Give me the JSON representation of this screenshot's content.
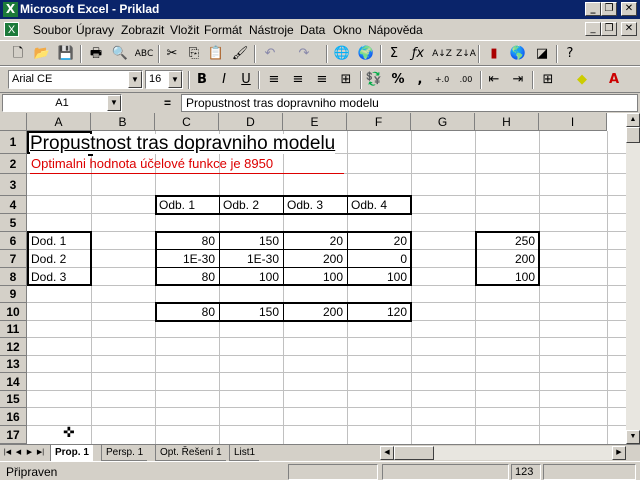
{
  "window": {
    "title": "Microsoft Excel - Priklad",
    "app_icon": "excel-x-icon"
  },
  "menu": [
    "Soubor",
    "Úpravy",
    "Zobrazit",
    "Vložit",
    "Formát",
    "Nástroje",
    "Data",
    "Okno",
    "Nápověda"
  ],
  "format_toolbar": {
    "font": "Arial CE",
    "size": "16"
  },
  "formula_bar": {
    "name_box": "A1",
    "eq": "=",
    "content": "Propustnost tras dopravniho modelu"
  },
  "columns": [
    "A",
    "B",
    "C",
    "D",
    "E",
    "F",
    "G",
    "H",
    "I"
  ],
  "rows": [
    "1",
    "2",
    "3",
    "4",
    "5",
    "6",
    "7",
    "8",
    "9",
    "10",
    "11",
    "12",
    "13",
    "14",
    "15",
    "16",
    "17"
  ],
  "sheet": {
    "a1": "Propustnost tras dopravniho modelu",
    "a2": "Optimalni hodnota účelové funkce je   8950",
    "headers": [
      "Odb. 1",
      "Odb. 2",
      "Odb. 3",
      "Odb. 4"
    ],
    "row_labels": [
      "Dod. 1",
      "Dod. 2",
      "Dod. 3"
    ],
    "matrix": [
      [
        "80",
        "150",
        "20",
        "20"
      ],
      [
        "1E-30",
        "1E-30",
        "200",
        "0"
      ],
      [
        "80",
        "100",
        "100",
        "100"
      ]
    ],
    "h_values": [
      "250",
      "200",
      "100"
    ],
    "totals": [
      "80",
      "150",
      "200",
      "120"
    ]
  },
  "tabs": [
    "Prop. 1",
    "Persp. 1",
    "Opt. Řešení 1",
    "List1"
  ],
  "active_tab": "Prop. 1",
  "status": {
    "text": "Připraven",
    "num": "123"
  }
}
